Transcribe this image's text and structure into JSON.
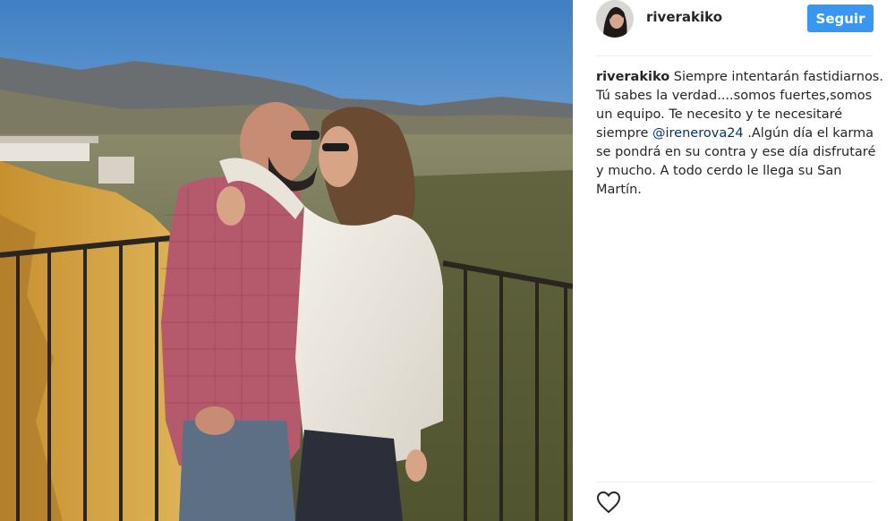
{
  "post": {
    "username": "riverakiko",
    "follow_label": "Seguir",
    "caption": {
      "username": "riverakiko",
      "text_before_mention": " Siempre intentarán fastidiarnos. Tú sabes la verdad....somos fuertes,somos un equipo. Te necesito y te necesitaré siempre ",
      "mention": "@irenerova24",
      "text_after_mention": " .Algún día el karma se pondrá en su contra y ese día disfrutaré y mucho. A todo cerdo le llega su San Martín."
    }
  },
  "icons": {
    "avatar": "profile-avatar",
    "like": "heart-outline-icon"
  },
  "colors": {
    "follow_button": "#3897f0",
    "mention": "#003569"
  }
}
